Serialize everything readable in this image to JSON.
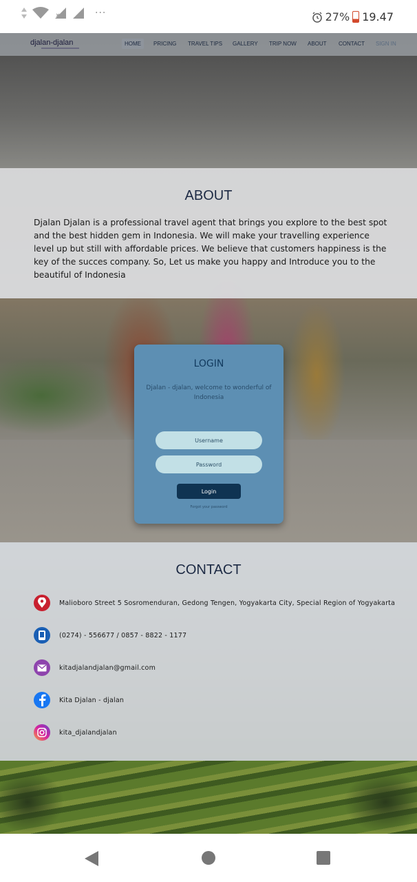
{
  "status": {
    "battery": "27%",
    "time": "19.47",
    "icons": [
      "signal-arrows-icon",
      "wifi-icon",
      "signal-icon",
      "signal-icon",
      "more-icon",
      "alarm-icon",
      "battery-icon"
    ]
  },
  "nav": {
    "logo": "djalan-djalan",
    "items": [
      "HOME",
      "PRICING",
      "TRAVEL TIPS",
      "GALLERY",
      "TRIP NOW",
      "ABOUT",
      "CONTACT",
      "SIGN IN"
    ]
  },
  "about": {
    "title": "ABOUT",
    "text": "Djalan Djalan is a professional travel agent that brings you explore to the best spot and the best hidden gem in Indonesia. We will make your travelling experience level up but still with affordable prices. We believe that customers happiness is the key of the succes company. So, Let us make you happy and Introduce you to the beautiful of Indonesia"
  },
  "login": {
    "title": "LOGIN",
    "subtitle": "Djalan - djalan, welcome to wonderful of Indonesia",
    "username_placeholder": "Username",
    "password_placeholder": "Password",
    "button": "Login",
    "forgot": "Forgot your password"
  },
  "contact": {
    "title": "CONTACT",
    "items": [
      {
        "icon": "location-pin-icon",
        "text": "Malioboro Street 5 Sosromenduran, Gedong Tengen, Yogyakarta City, Special Region of Yogyakarta",
        "color": "#c8202f"
      },
      {
        "icon": "phone-icon",
        "text": "(0274) - 556677 / 0857 - 8822 - 1177",
        "color": "#1a5fb4"
      },
      {
        "icon": "email-icon",
        "text": "kitadjalandjalan@gmail.com",
        "color": "#8e44ad"
      },
      {
        "icon": "facebook-icon",
        "text": "Kita Djalan - djalan",
        "color": "#1877f2"
      },
      {
        "icon": "instagram-icon",
        "text": "kita_djalandjalan",
        "color": "#d6249f"
      }
    ]
  },
  "system_nav": [
    "back-icon",
    "home-icon",
    "recents-icon"
  ]
}
